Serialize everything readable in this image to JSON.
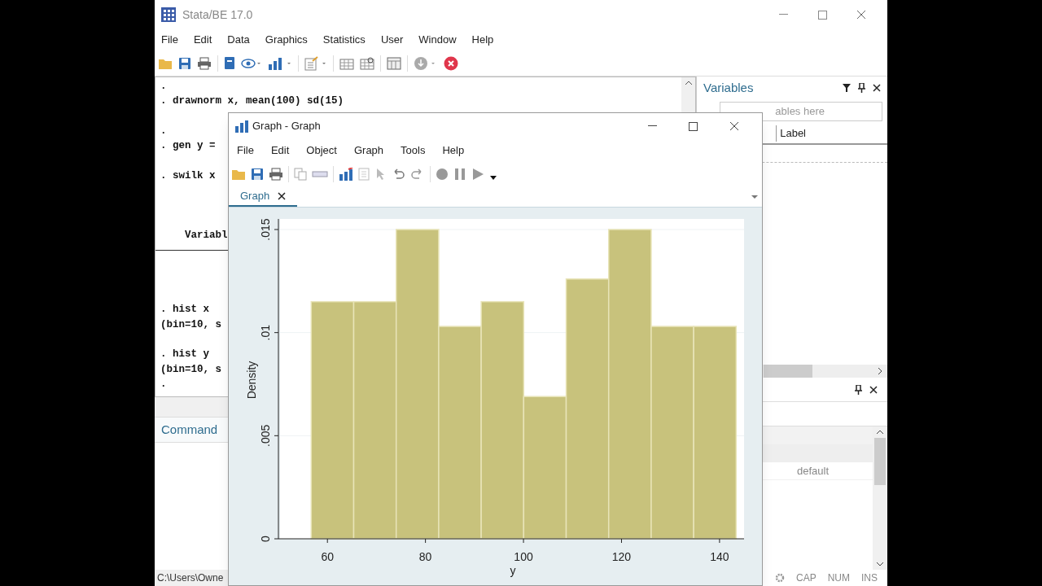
{
  "window": {
    "title": "Stata/BE 17.0"
  },
  "menu": [
    "File",
    "Edit",
    "Data",
    "Graphics",
    "Statistics",
    "User",
    "Window",
    "Help"
  ],
  "results": {
    "lines": [
      {
        "kind": "text",
        "text": "."
      },
      {
        "kind": "text",
        "text": ". drawnorm x, mean(100) sd(15)"
      },
      {
        "kind": "blank"
      },
      {
        "kind": "text",
        "text": "."
      },
      {
        "kind": "text",
        "text": ". gen y ="
      },
      {
        "kind": "blank"
      },
      {
        "kind": "text",
        "text": ". swilk x"
      },
      {
        "kind": "blank"
      },
      {
        "kind": "blank"
      },
      {
        "kind": "blank"
      },
      {
        "kind": "text",
        "text": "    Variabl"
      },
      {
        "kind": "rule"
      },
      {
        "kind": "blank"
      },
      {
        "kind": "blank"
      },
      {
        "kind": "blank"
      },
      {
        "kind": "text",
        "text": ". hist x"
      },
      {
        "kind": "text",
        "text": "(bin=10, s"
      },
      {
        "kind": "blank"
      },
      {
        "kind": "text",
        "text": ". hist y"
      },
      {
        "kind": "text",
        "text": "(bin=10, s"
      },
      {
        "kind": "text",
        "text": "."
      }
    ]
  },
  "command": {
    "title": "Command"
  },
  "variables": {
    "title": "Variables",
    "search_placeholder": "ables here",
    "columns": [
      "Label"
    ]
  },
  "properties": {
    "values": [
      "default"
    ]
  },
  "status_bar": {
    "path": "C:\\Users\\Owne",
    "indicators": [
      "CAP",
      "NUM",
      "INS"
    ]
  },
  "graph_window": {
    "title": "Graph - Graph",
    "menu": [
      "File",
      "Edit",
      "Object",
      "Graph",
      "Tools",
      "Help"
    ],
    "tabs": [
      {
        "label": "Graph",
        "selected": true
      }
    ],
    "chart_data": {
      "type": "bar",
      "xlabel": "y",
      "ylabel": "Density",
      "x": [
        61.03,
        69.7,
        78.37,
        87.04,
        95.71,
        104.38,
        113.05,
        121.72,
        130.39,
        139.06
      ],
      "series": [
        {
          "color": "#c8c27c",
          "values": [
            0.0115,
            0.0115,
            0.015,
            0.0103,
            0.0115,
            0.0069,
            0.0126,
            0.015,
            0.0103,
            0.0103
          ]
        }
      ],
      "xlim": [
        50,
        145
      ],
      "ylim": [
        0,
        0.015
      ],
      "xticks": [
        60,
        80,
        100,
        120,
        140
      ],
      "yticks": [
        {
          "value": 0,
          "label": "0"
        },
        {
          "value": 0.005,
          "label": ".005"
        },
        {
          "value": 0.01,
          "label": ".01"
        },
        {
          "value": 0.015,
          "label": ".015"
        }
      ]
    }
  }
}
